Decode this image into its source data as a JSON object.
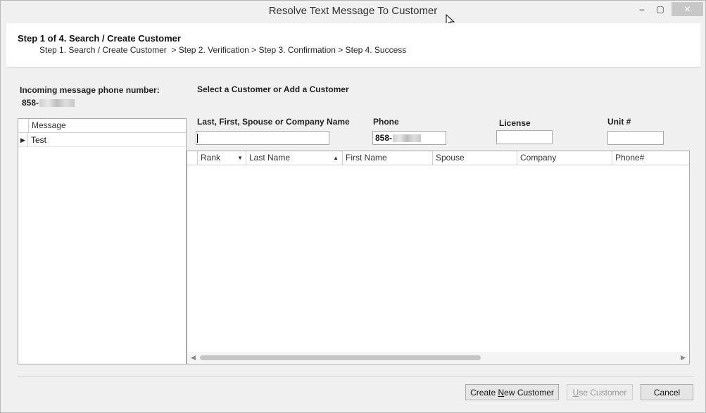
{
  "window": {
    "title": "Resolve Text Message To Customer",
    "min_glyph": "–",
    "max_glyph": "▢",
    "close_glyph": "✕"
  },
  "header": {
    "step_title": "Step 1 of 4. Search / Create Customer",
    "step_path": "Step 1. Search / Create Customer  > Step 2. Verification > Step 3. Confirmation > Step 4. Success"
  },
  "incoming": {
    "label": "Incoming message phone number:",
    "phone_prefix": "858-"
  },
  "messages": {
    "column": "Message",
    "rows": [
      {
        "indicator": "▶",
        "text": "Test"
      }
    ]
  },
  "search": {
    "heading": "Select a Customer or Add a Customer",
    "name_label": "Last, First, Spouse or Company Name",
    "name_value": "",
    "phone_label": "Phone",
    "phone_prefix": "858-",
    "license_label": "License",
    "license_value": "",
    "unit_label": "Unit #",
    "unit_value": ""
  },
  "results": {
    "columns": [
      "Rank",
      "Last Name",
      "First Name",
      "Spouse",
      "Company",
      "Phone#"
    ],
    "rank_sort_glyph": "▼",
    "lastname_sort_glyph": "▲",
    "scroll_left": "◀",
    "scroll_right": "▶"
  },
  "buttons": {
    "create_new_pre": "Create ",
    "create_new_mnemonic": "N",
    "create_new_post": "ew Customer",
    "use_customer_mnemonic": "U",
    "use_customer_post": "se Customer",
    "cancel": "Cancel"
  }
}
